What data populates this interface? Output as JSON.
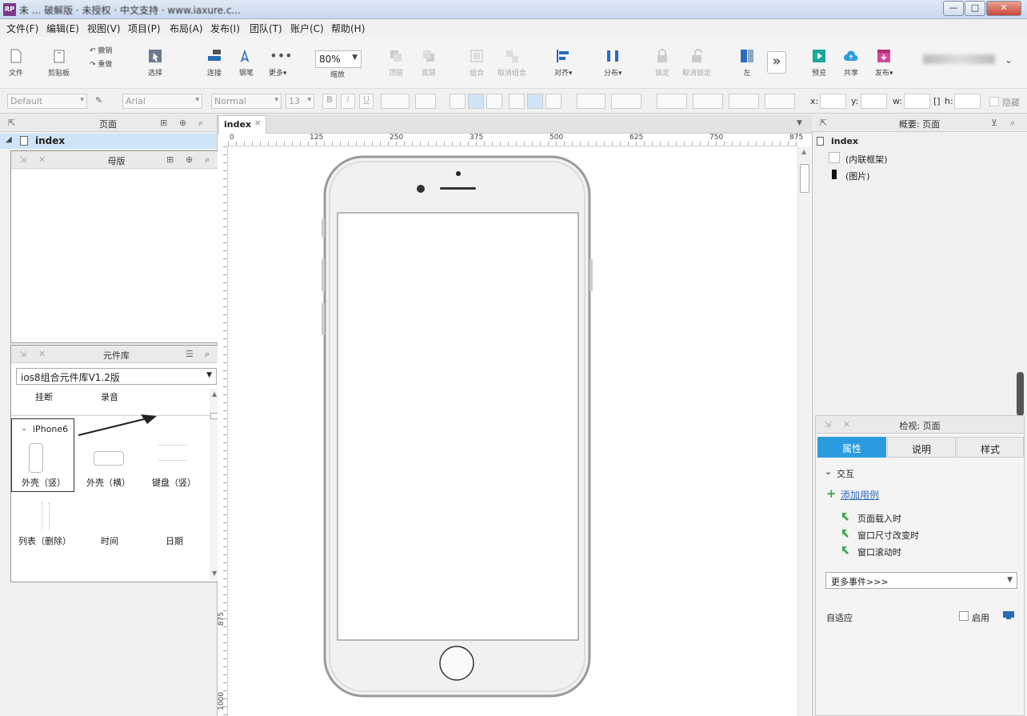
{
  "window": {
    "title": "未 ... 破解版 · 未授权 · 中文支持 · www.iaxure.c...",
    "min": "—",
    "max": "□",
    "close": "✕"
  },
  "menu": [
    "文件(F)",
    "编辑(E)",
    "视图(V)",
    "项目(P)",
    "布局(A)",
    "发布(I)",
    "团队(T)",
    "账户(C)",
    "帮助(H)"
  ],
  "toolbar": {
    "file": "文件",
    "clipboard": "剪贴板",
    "undo": "撤销",
    "redo": "重做",
    "select": "选择",
    "connect": "连接",
    "pen": "钢笔",
    "more": "更多▾",
    "zoom_value": "80%",
    "zoom_label": "缩放",
    "top": "顶层",
    "bottom": "底层",
    "group": "组合",
    "ungroup": "取消组合",
    "align": "对齐▾",
    "distribute": "分布▾",
    "lock": "锁定",
    "unlock": "取消锁定",
    "left": "左",
    "preview": "预览",
    "share": "共享",
    "publish": "发布▾"
  },
  "formatbar": {
    "style": "Default",
    "font": "Arial",
    "weight": "Normal",
    "size": "13",
    "x": "x:",
    "y": "y:",
    "w": "w:",
    "h": "h:",
    "hide": "隐藏"
  },
  "pages_panel": {
    "title": "页面",
    "root": "index"
  },
  "masters_panel": {
    "title": "母版"
  },
  "library_panel": {
    "title": "元件库",
    "selected_library": "ios8组合元件库V1.2版",
    "top_items": [
      "挂断",
      "录音"
    ],
    "group_name": "iPhone6",
    "items_row1": [
      "外壳（竖）",
      "外壳（横）",
      "键盘（竖）"
    ],
    "items_row2": [
      "列表（删除）",
      "时间",
      "日期"
    ]
  },
  "canvas": {
    "tab": "index",
    "ruler_h": [
      "0",
      "125",
      "250",
      "375",
      "500",
      "625",
      "750",
      "875"
    ],
    "ruler_v": [
      "875",
      "1000"
    ]
  },
  "outline_panel": {
    "title": "概要: 页面",
    "page": "index",
    "items": [
      "(内联框架)",
      "(图片)"
    ]
  },
  "inspector": {
    "title": "检视: 页面",
    "tabs": [
      "属性",
      "说明",
      "样式"
    ],
    "section": "交互",
    "add_case": "添加用例",
    "events": [
      "页面载入时",
      "窗口尺寸改变时",
      "窗口滚动时"
    ],
    "more_events": "更多事件>>>",
    "adaptive": "自适应",
    "enable": "启用"
  },
  "colors": {
    "accent": "#2b9be0",
    "tab_active": "#2b9be0",
    "selection": "#cfe5f7",
    "icon_green": "#3aa84a"
  }
}
